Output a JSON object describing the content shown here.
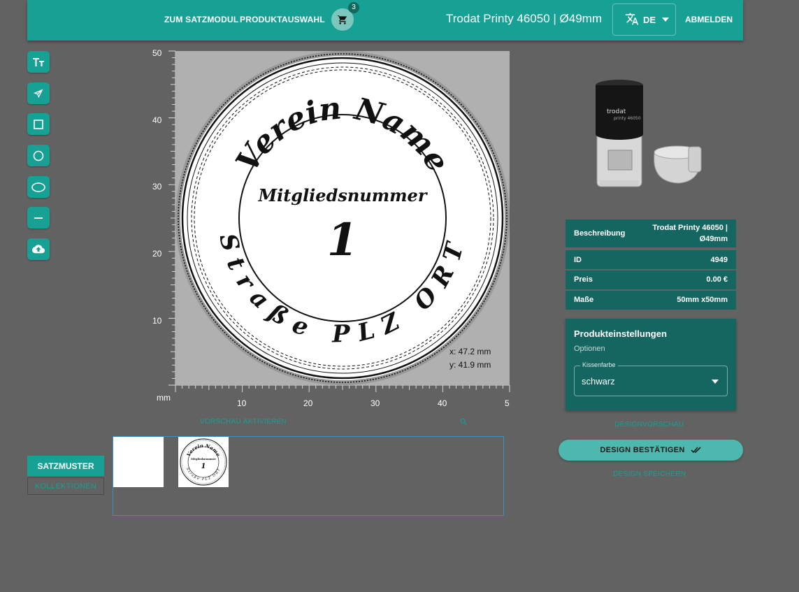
{
  "header": {
    "nav_satzmodul": "ZUM SATZMODUL",
    "nav_produktauswahl": "PRODUKTAUSWAHL",
    "cart_count": "3",
    "product_title": "Trodat Printy 46050 | Ø49mm",
    "language": "DE",
    "logout": "ABMELDEN"
  },
  "tools": [
    {
      "icon": "text-icon"
    },
    {
      "icon": "send-arrow-icon"
    },
    {
      "icon": "square-icon"
    },
    {
      "icon": "circle-icon"
    },
    {
      "icon": "ellipse-icon"
    },
    {
      "icon": "line-icon"
    },
    {
      "icon": "cloud-upload-icon"
    }
  ],
  "canvas": {
    "unit": "mm",
    "y_ticks": [
      "50",
      "40",
      "30",
      "20",
      "10"
    ],
    "x_ticks": [
      "10",
      "20",
      "30",
      "40",
      "5"
    ],
    "stamp": {
      "top_text": "Verein Name",
      "bottom_text": "Straße PLZ ORT",
      "center_label": "Mitgliedsnummer",
      "center_number": "1"
    },
    "coord_x": "x: 47.2 mm",
    "coord_y": "y: 41.9 mm",
    "preview_toggle": "VORSCHAU AKTIVIEREN"
  },
  "templates": {
    "tab_satzmuster": "SATZMUSTER",
    "tab_kollektionen": "KOLLEKTIONEN",
    "thumb": {
      "top_text": "Verein Name",
      "center_label": "Mitgliedsnummer",
      "center_number": "1",
      "bottom_text": "Straße PLZ ORT"
    }
  },
  "product_info": {
    "rows": [
      {
        "key": "Beschreibung",
        "value_line1": "Trodat Printy 46050 |",
        "value_line2": "Ø49mm"
      },
      {
        "key": "ID",
        "value": "4949"
      },
      {
        "key": "Preis",
        "value": "0.00 €"
      },
      {
        "key": "Maße",
        "value": "50mm x50mm"
      }
    ]
  },
  "settings": {
    "title": "Produkteinstellungen",
    "subtitle": "Optionen",
    "field_label": "Kissenfarbe",
    "field_value": "schwarz"
  },
  "actions": {
    "design_preview": "DESIGNVORSCHAU",
    "confirm": "DESIGN BESTÄTIGEN",
    "save": "DESIGN SPEICHERN"
  },
  "stamp_product": {
    "brand": "trodat",
    "model": "printy 46050"
  },
  "colors": {
    "accent": "#17a194",
    "panel": "#156661",
    "background": "#626262"
  }
}
